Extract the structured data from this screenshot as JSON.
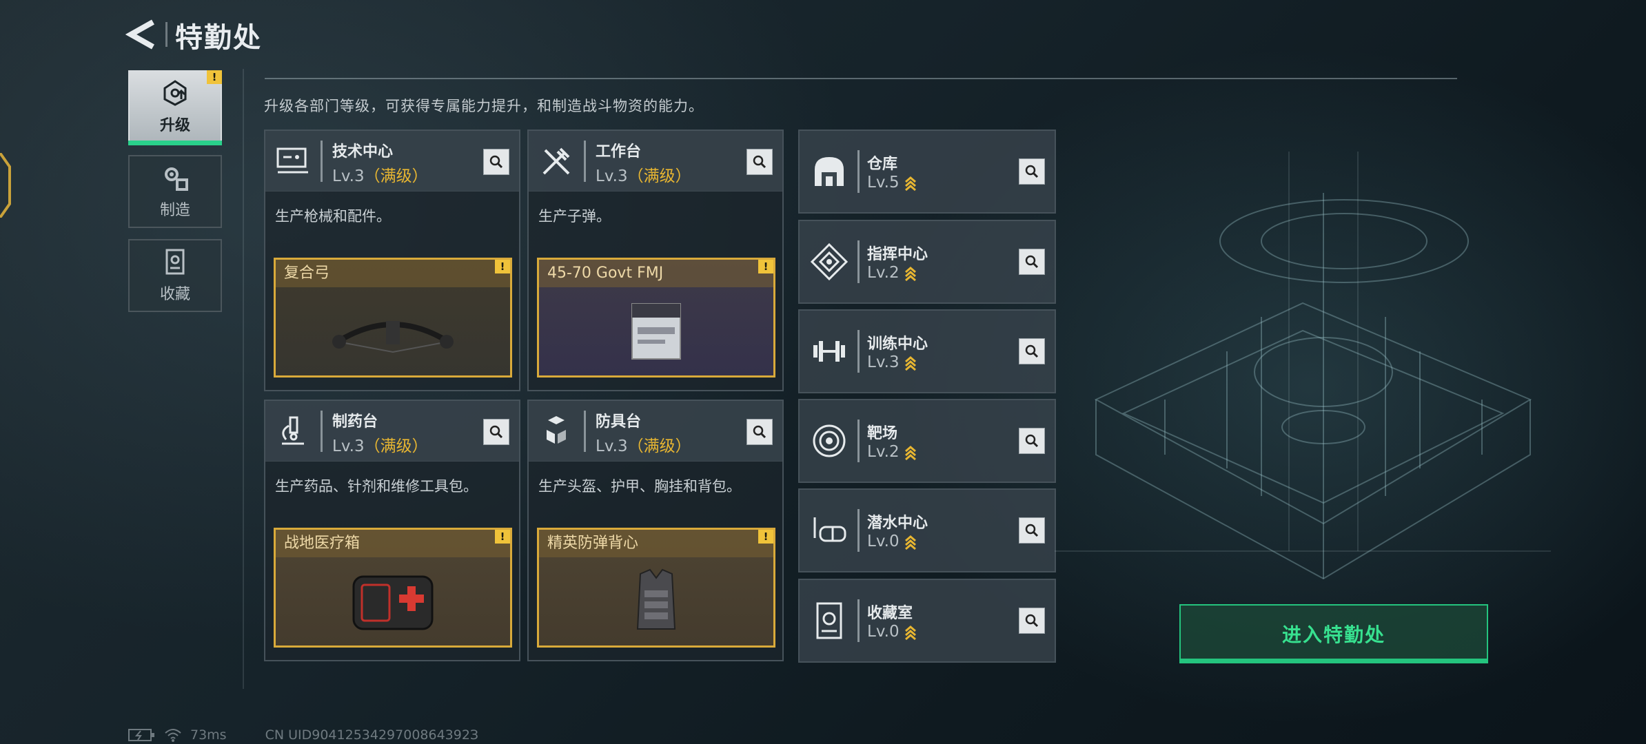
{
  "header": {
    "title": "特勤处"
  },
  "nav": {
    "items": [
      {
        "label": "升级",
        "icon": "upgrade-icon",
        "active": true,
        "badge": "!"
      },
      {
        "label": "制造",
        "icon": "gears-icon",
        "active": false
      },
      {
        "label": "收藏",
        "icon": "collection-icon",
        "active": false
      }
    ]
  },
  "description": "升级各部门等级，可获得专属能力提升，和制造战斗物资的能力。",
  "cards": [
    {
      "name": "技术中心",
      "level": "Lv.3",
      "maxed": "（满级）",
      "desc": "生产枪械和配件。",
      "product": "复合弓",
      "product_badge": "!"
    },
    {
      "name": "工作台",
      "level": "Lv.3",
      "maxed": "（满级）",
      "desc": "生产子弹。",
      "product": "45-70 Govt FMJ",
      "product_badge": "!"
    },
    {
      "name": "制药台",
      "level": "Lv.3",
      "maxed": "（满级）",
      "desc": "生产药品、针剂和维修工具包。",
      "product": "战地医疗箱",
      "product_badge": "!"
    },
    {
      "name": "防具台",
      "level": "Lv.3",
      "maxed": "（满级）",
      "desc": "生产头盔、护甲、胸挂和背包。",
      "product": "精英防弹背心",
      "product_badge": "!"
    }
  ],
  "departments": [
    {
      "name": "仓库",
      "level": "Lv.5"
    },
    {
      "name": "指挥中心",
      "level": "Lv.2"
    },
    {
      "name": "训练中心",
      "level": "Lv.3"
    },
    {
      "name": "靶场",
      "level": "Lv.2"
    },
    {
      "name": "潜水中心",
      "level": "Lv.0"
    },
    {
      "name": "收藏室",
      "level": "Lv.0"
    }
  ],
  "enter_button": "进入特勤处",
  "status": {
    "ping": "73ms",
    "uid": "CN UID9041253429700864392З"
  },
  "colors": {
    "accent_green": "#2ad18b",
    "gold": "#e8b631",
    "badge_yellow": "#f0c33a"
  }
}
